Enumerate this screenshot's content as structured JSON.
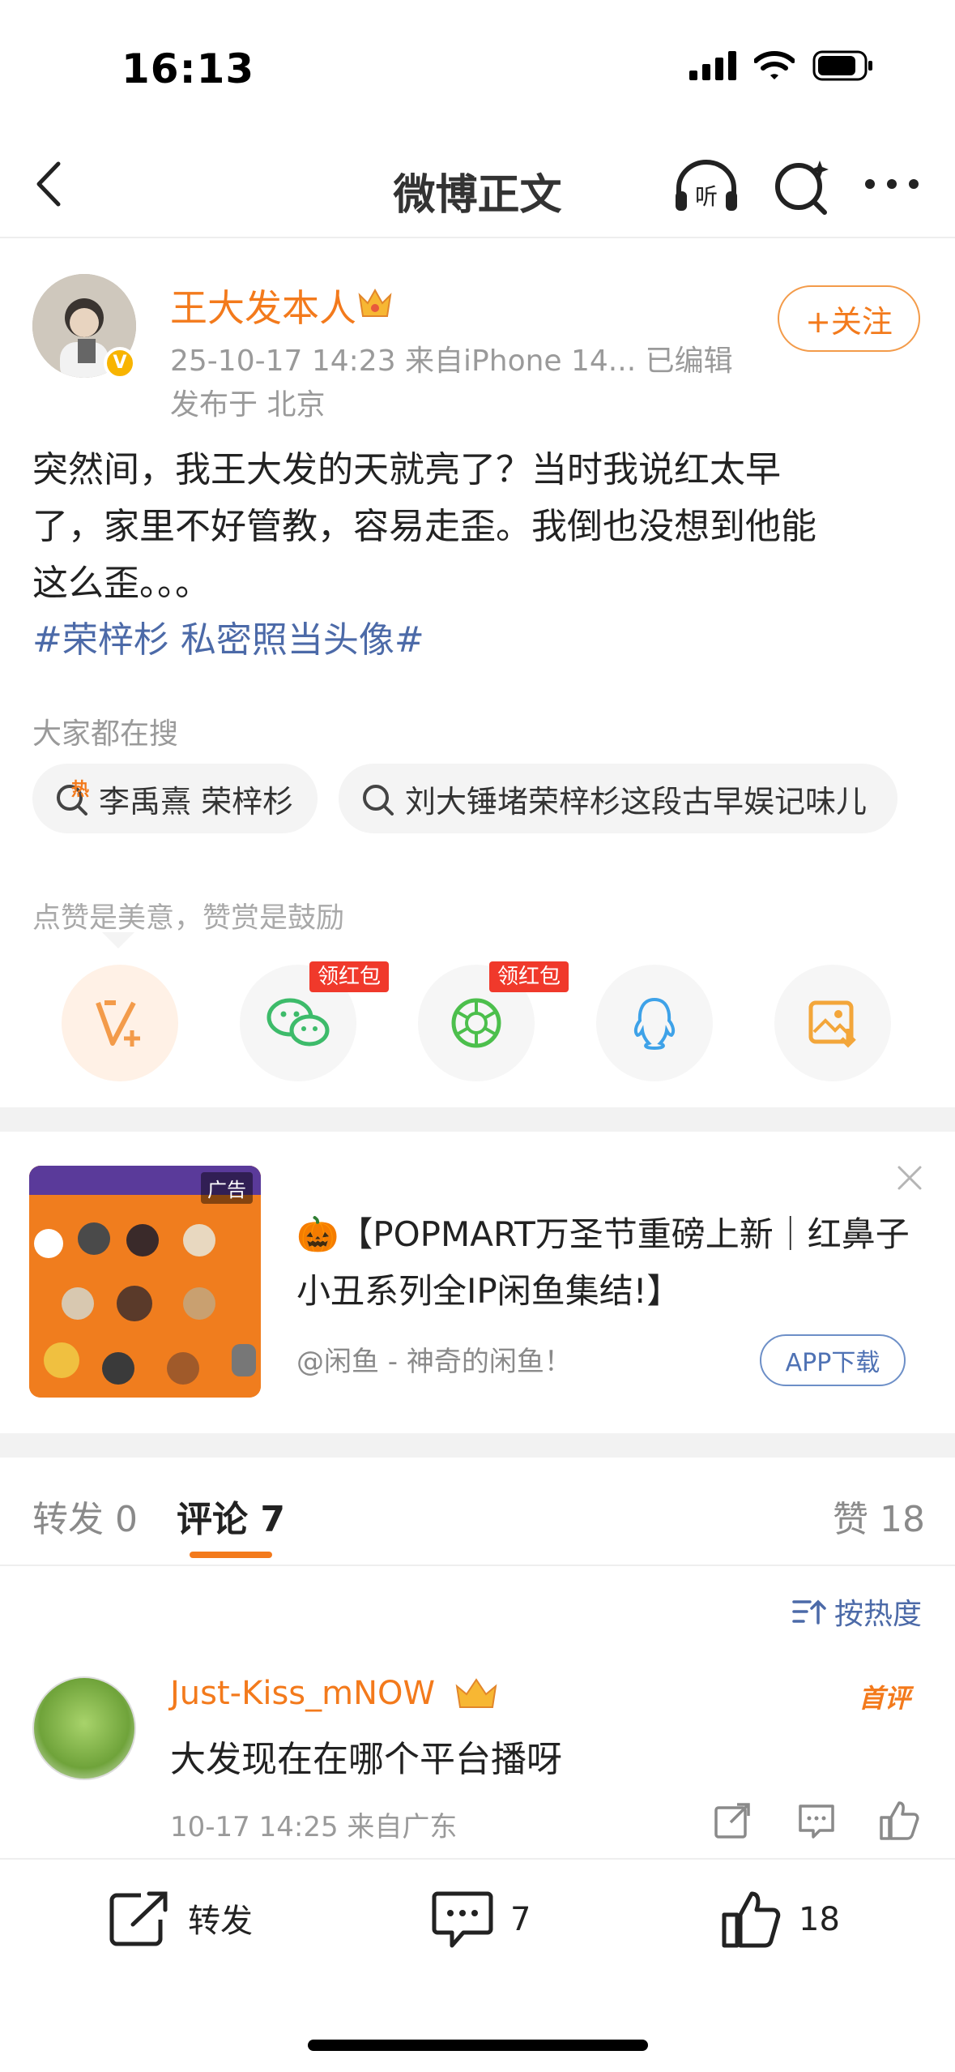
{
  "status_bar": {
    "time": "16:13"
  },
  "nav": {
    "title": "微博正文",
    "listen_label": "听"
  },
  "post": {
    "author": "王大发本人",
    "avatar_badge": "V",
    "meta_line": "25-10-17 14:23  来自iPhone 14...  已编辑",
    "location_line": "发布于 北京",
    "follow_label": "+关注",
    "text_line1": "突然间，我王大发的天就亮了？当时我说红太早",
    "text_line2": "了，家里不好管教，容易走歪。我倒也没想到他能",
    "text_line3": "这么歪。。。",
    "hashtag": "#荣梓杉 私密照当头像#"
  },
  "search": {
    "label": "大家都在搜",
    "chips": [
      {
        "text": "李禹熹 荣梓杉",
        "badge": "热"
      },
      {
        "text": "刘大锤堵荣梓杉这段古早娱记味儿"
      }
    ]
  },
  "reward": {
    "label": "点赞是美意，赞赏是鼓励",
    "redpack_label": "领红包"
  },
  "ad": {
    "title": "🎃【POPMART万圣节重磅上新｜红鼻子小丑系列全IP闲鱼集结!】",
    "source": "@闲鱼 - 神奇的闲鱼！",
    "button": "APP下载",
    "image_tag": "广告"
  },
  "tabs": [
    {
      "label": "转发 0"
    },
    {
      "label": "评论 7"
    },
    {
      "label": "赞 18"
    }
  ],
  "sort_label": "按热度",
  "comment": {
    "user": "Just-Kiss_mNOW",
    "first_badge": "首评",
    "text": "大发现在在哪个平台播呀",
    "meta": "10-17 14:25  来自广东"
  },
  "bottom_bar": {
    "repost": "转发",
    "comments": "7",
    "likes": "18"
  },
  "colors": {
    "accent": "#f37a1c",
    "link": "#4c6aa8",
    "redpack": "#f0392b"
  }
}
